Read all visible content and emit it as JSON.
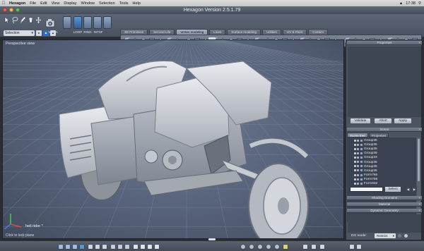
{
  "menubar": {
    "items": [
      "Hexagon",
      "File",
      "Edit",
      "View",
      "Display",
      "Window",
      "Selection",
      "Tools",
      "Help"
    ],
    "clock": "17:38"
  },
  "window": {
    "title": "Hexagon Version 2.5.1.79"
  },
  "toolbar": {
    "selection_mode": "Selection",
    "camera_label": "CAMERA",
    "select_labels": [
      "LOOP",
      "RING",
      "INTSF"
    ]
  },
  "tabs": [
    {
      "label": "3D Primitives",
      "active": false
    },
    {
      "label": "Second Life",
      "active": false
    },
    {
      "label": "Vertex modeling",
      "active": true
    },
    {
      "label": "Lines",
      "active": false
    },
    {
      "label": "Surface modeling",
      "active": false
    },
    {
      "label": "Utilities",
      "active": false
    },
    {
      "label": "UV & Paint",
      "active": false
    },
    {
      "label": "Custom",
      "active": false
    }
  ],
  "viewport": {
    "label": "Perspective view",
    "hover_object": "hell rider *",
    "hint": "Click to lock plane"
  },
  "panel": {
    "properties_title": "Properties",
    "buttons": [
      "Validate",
      "Abort",
      "Apply"
    ],
    "scene_title": "Scene",
    "scene_tabs": [
      {
        "label": "Scene tree",
        "active": true
      },
      {
        "label": "Properties",
        "active": false
      }
    ],
    "scene_rows": [
      "Group36",
      "Group35",
      "Group36",
      "Group39",
      "Group33",
      "Group35",
      "Group36",
      "Group36",
      "Form766",
      "Form768",
      "Form632"
    ],
    "select_button": "Select",
    "shading_title": "Shading Domains",
    "material_title": "Material",
    "dynamic_title": "Dynamic Geometry",
    "dg_mode_label": "DG mode:",
    "dg_mode_value": "Restrict"
  },
  "colors": {
    "accent_blue": "#2d6fc4",
    "viewport_bg": "#5f6b80",
    "model_gray": "#c9ccd2"
  }
}
